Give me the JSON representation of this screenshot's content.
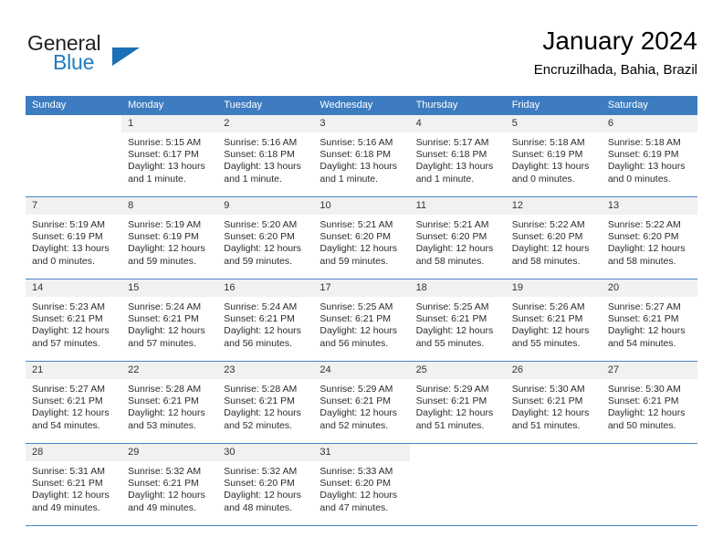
{
  "brand": {
    "name_top": "General",
    "name_bottom": "Blue",
    "triangle_color": "#1b6fb5",
    "text_color": "#231f20",
    "blue_color": "#1f7bc1"
  },
  "header": {
    "title": "January 2024",
    "location": "Encruzilhada, Bahia, Brazil"
  },
  "theme": {
    "header_bg": "#3d7cc0",
    "header_text": "#ffffff",
    "daynum_bg": "#f1f1f1",
    "row_divider": "#4a82c4"
  },
  "weekdays": [
    "Sunday",
    "Monday",
    "Tuesday",
    "Wednesday",
    "Thursday",
    "Friday",
    "Saturday"
  ],
  "weeks": [
    [
      {
        "day": "",
        "sunrise": "",
        "sunset": "",
        "daylight_line1": "",
        "daylight_line2": "",
        "empty": true
      },
      {
        "day": "1",
        "sunrise": "Sunrise: 5:15 AM",
        "sunset": "Sunset: 6:17 PM",
        "daylight_line1": "Daylight: 13 hours",
        "daylight_line2": "and 1 minute."
      },
      {
        "day": "2",
        "sunrise": "Sunrise: 5:16 AM",
        "sunset": "Sunset: 6:18 PM",
        "daylight_line1": "Daylight: 13 hours",
        "daylight_line2": "and 1 minute."
      },
      {
        "day": "3",
        "sunrise": "Sunrise: 5:16 AM",
        "sunset": "Sunset: 6:18 PM",
        "daylight_line1": "Daylight: 13 hours",
        "daylight_line2": "and 1 minute."
      },
      {
        "day": "4",
        "sunrise": "Sunrise: 5:17 AM",
        "sunset": "Sunset: 6:18 PM",
        "daylight_line1": "Daylight: 13 hours",
        "daylight_line2": "and 1 minute."
      },
      {
        "day": "5",
        "sunrise": "Sunrise: 5:18 AM",
        "sunset": "Sunset: 6:19 PM",
        "daylight_line1": "Daylight: 13 hours",
        "daylight_line2": "and 0 minutes."
      },
      {
        "day": "6",
        "sunrise": "Sunrise: 5:18 AM",
        "sunset": "Sunset: 6:19 PM",
        "daylight_line1": "Daylight: 13 hours",
        "daylight_line2": "and 0 minutes."
      }
    ],
    [
      {
        "day": "7",
        "sunrise": "Sunrise: 5:19 AM",
        "sunset": "Sunset: 6:19 PM",
        "daylight_line1": "Daylight: 13 hours",
        "daylight_line2": "and 0 minutes."
      },
      {
        "day": "8",
        "sunrise": "Sunrise: 5:19 AM",
        "sunset": "Sunset: 6:19 PM",
        "daylight_line1": "Daylight: 12 hours",
        "daylight_line2": "and 59 minutes."
      },
      {
        "day": "9",
        "sunrise": "Sunrise: 5:20 AM",
        "sunset": "Sunset: 6:20 PM",
        "daylight_line1": "Daylight: 12 hours",
        "daylight_line2": "and 59 minutes."
      },
      {
        "day": "10",
        "sunrise": "Sunrise: 5:21 AM",
        "sunset": "Sunset: 6:20 PM",
        "daylight_line1": "Daylight: 12 hours",
        "daylight_line2": "and 59 minutes."
      },
      {
        "day": "11",
        "sunrise": "Sunrise: 5:21 AM",
        "sunset": "Sunset: 6:20 PM",
        "daylight_line1": "Daylight: 12 hours",
        "daylight_line2": "and 58 minutes."
      },
      {
        "day": "12",
        "sunrise": "Sunrise: 5:22 AM",
        "sunset": "Sunset: 6:20 PM",
        "daylight_line1": "Daylight: 12 hours",
        "daylight_line2": "and 58 minutes."
      },
      {
        "day": "13",
        "sunrise": "Sunrise: 5:22 AM",
        "sunset": "Sunset: 6:20 PM",
        "daylight_line1": "Daylight: 12 hours",
        "daylight_line2": "and 58 minutes."
      }
    ],
    [
      {
        "day": "14",
        "sunrise": "Sunrise: 5:23 AM",
        "sunset": "Sunset: 6:21 PM",
        "daylight_line1": "Daylight: 12 hours",
        "daylight_line2": "and 57 minutes."
      },
      {
        "day": "15",
        "sunrise": "Sunrise: 5:24 AM",
        "sunset": "Sunset: 6:21 PM",
        "daylight_line1": "Daylight: 12 hours",
        "daylight_line2": "and 57 minutes."
      },
      {
        "day": "16",
        "sunrise": "Sunrise: 5:24 AM",
        "sunset": "Sunset: 6:21 PM",
        "daylight_line1": "Daylight: 12 hours",
        "daylight_line2": "and 56 minutes."
      },
      {
        "day": "17",
        "sunrise": "Sunrise: 5:25 AM",
        "sunset": "Sunset: 6:21 PM",
        "daylight_line1": "Daylight: 12 hours",
        "daylight_line2": "and 56 minutes."
      },
      {
        "day": "18",
        "sunrise": "Sunrise: 5:25 AM",
        "sunset": "Sunset: 6:21 PM",
        "daylight_line1": "Daylight: 12 hours",
        "daylight_line2": "and 55 minutes."
      },
      {
        "day": "19",
        "sunrise": "Sunrise: 5:26 AM",
        "sunset": "Sunset: 6:21 PM",
        "daylight_line1": "Daylight: 12 hours",
        "daylight_line2": "and 55 minutes."
      },
      {
        "day": "20",
        "sunrise": "Sunrise: 5:27 AM",
        "sunset": "Sunset: 6:21 PM",
        "daylight_line1": "Daylight: 12 hours",
        "daylight_line2": "and 54 minutes."
      }
    ],
    [
      {
        "day": "21",
        "sunrise": "Sunrise: 5:27 AM",
        "sunset": "Sunset: 6:21 PM",
        "daylight_line1": "Daylight: 12 hours",
        "daylight_line2": "and 54 minutes."
      },
      {
        "day": "22",
        "sunrise": "Sunrise: 5:28 AM",
        "sunset": "Sunset: 6:21 PM",
        "daylight_line1": "Daylight: 12 hours",
        "daylight_line2": "and 53 minutes."
      },
      {
        "day": "23",
        "sunrise": "Sunrise: 5:28 AM",
        "sunset": "Sunset: 6:21 PM",
        "daylight_line1": "Daylight: 12 hours",
        "daylight_line2": "and 52 minutes."
      },
      {
        "day": "24",
        "sunrise": "Sunrise: 5:29 AM",
        "sunset": "Sunset: 6:21 PM",
        "daylight_line1": "Daylight: 12 hours",
        "daylight_line2": "and 52 minutes."
      },
      {
        "day": "25",
        "sunrise": "Sunrise: 5:29 AM",
        "sunset": "Sunset: 6:21 PM",
        "daylight_line1": "Daylight: 12 hours",
        "daylight_line2": "and 51 minutes."
      },
      {
        "day": "26",
        "sunrise": "Sunrise: 5:30 AM",
        "sunset": "Sunset: 6:21 PM",
        "daylight_line1": "Daylight: 12 hours",
        "daylight_line2": "and 51 minutes."
      },
      {
        "day": "27",
        "sunrise": "Sunrise: 5:30 AM",
        "sunset": "Sunset: 6:21 PM",
        "daylight_line1": "Daylight: 12 hours",
        "daylight_line2": "and 50 minutes."
      }
    ],
    [
      {
        "day": "28",
        "sunrise": "Sunrise: 5:31 AM",
        "sunset": "Sunset: 6:21 PM",
        "daylight_line1": "Daylight: 12 hours",
        "daylight_line2": "and 49 minutes."
      },
      {
        "day": "29",
        "sunrise": "Sunrise: 5:32 AM",
        "sunset": "Sunset: 6:21 PM",
        "daylight_line1": "Daylight: 12 hours",
        "daylight_line2": "and 49 minutes."
      },
      {
        "day": "30",
        "sunrise": "Sunrise: 5:32 AM",
        "sunset": "Sunset: 6:20 PM",
        "daylight_line1": "Daylight: 12 hours",
        "daylight_line2": "and 48 minutes."
      },
      {
        "day": "31",
        "sunrise": "Sunrise: 5:33 AM",
        "sunset": "Sunset: 6:20 PM",
        "daylight_line1": "Daylight: 12 hours",
        "daylight_line2": "and 47 minutes."
      },
      {
        "day": "",
        "sunrise": "",
        "sunset": "",
        "daylight_line1": "",
        "daylight_line2": "",
        "empty": true
      },
      {
        "day": "",
        "sunrise": "",
        "sunset": "",
        "daylight_line1": "",
        "daylight_line2": "",
        "empty": true
      },
      {
        "day": "",
        "sunrise": "",
        "sunset": "",
        "daylight_line1": "",
        "daylight_line2": "",
        "empty": true
      }
    ]
  ]
}
